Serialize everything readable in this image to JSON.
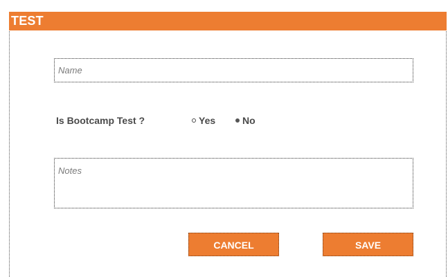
{
  "header": {
    "title": "TEST"
  },
  "form": {
    "name_placeholder": "Name",
    "question_label": "Is Bootcamp Test ?",
    "radio_options": [
      {
        "label": "Yes",
        "selected": false
      },
      {
        "label": "No",
        "selected": true
      }
    ],
    "notes_placeholder": "Notes",
    "cancel_label": "CANCEL",
    "save_label": "SAVE"
  },
  "colors": {
    "accent": "#ed7d31",
    "text": "#4a4a4a",
    "placeholder": "#7a7a7a"
  }
}
